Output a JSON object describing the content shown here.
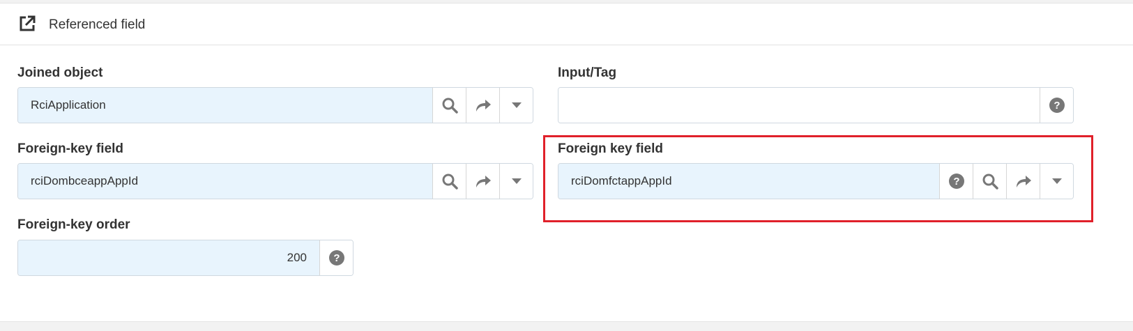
{
  "header": {
    "title": "Referenced field",
    "icon": "external-link-icon"
  },
  "joined_object": {
    "label": "Joined object",
    "value": "RciApplication"
  },
  "input_tag": {
    "label": "Input/Tag",
    "value": ""
  },
  "foreign_key_field_left": {
    "label": "Foreign-key field",
    "value": "rciDombceappAppId"
  },
  "foreign_key_field_right": {
    "label": "Foreign key field",
    "value": "rciDomfctappAppId"
  },
  "foreign_key_order": {
    "label": "Foreign-key order",
    "value": "200"
  },
  "colors": {
    "input_bg": "#e8f4fd",
    "highlight": "#e0202a",
    "icon": "#777777"
  }
}
